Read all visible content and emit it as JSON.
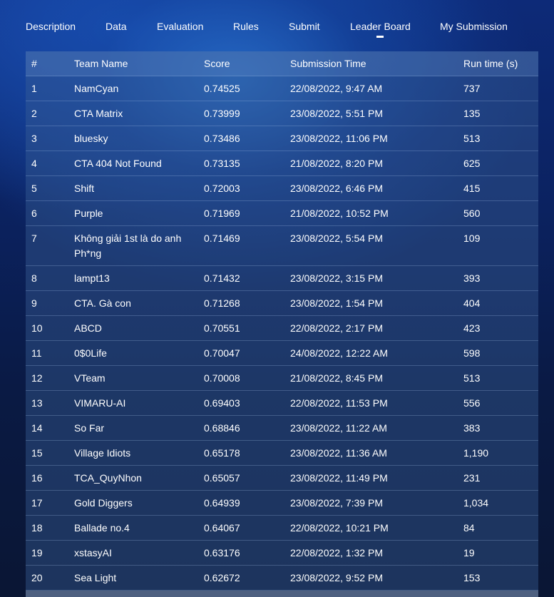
{
  "nav": {
    "items": [
      {
        "label": "Description"
      },
      {
        "label": "Data"
      },
      {
        "label": "Evaluation"
      },
      {
        "label": "Rules"
      },
      {
        "label": "Submit"
      },
      {
        "label": "Leader Board",
        "active": true
      },
      {
        "label": "My Submission"
      }
    ]
  },
  "table": {
    "headers": {
      "rank": "#",
      "team": "Team Name",
      "score": "Score",
      "time": "Submission Time",
      "run": "Run time (s)"
    },
    "rows": [
      {
        "rank": "1",
        "team": "NamCyan",
        "score": "0.74525",
        "time": "22/08/2022, 9:47 AM",
        "run": "737"
      },
      {
        "rank": "2",
        "team": "CTA Matrix",
        "score": "0.73999",
        "time": "23/08/2022, 5:51 PM",
        "run": "135"
      },
      {
        "rank": "3",
        "team": "bluesky",
        "score": "0.73486",
        "time": "23/08/2022, 11:06 PM",
        "run": "513"
      },
      {
        "rank": "4",
        "team": "CTA 404 Not Found",
        "score": "0.73135",
        "time": "21/08/2022, 8:20 PM",
        "run": "625"
      },
      {
        "rank": "5",
        "team": "Shift",
        "score": "0.72003",
        "time": "23/08/2022, 6:46 PM",
        "run": "415"
      },
      {
        "rank": "6",
        "team": "Purple",
        "score": "0.71969",
        "time": "21/08/2022, 10:52 PM",
        "run": "560"
      },
      {
        "rank": "7",
        "team": "Không giải 1st là do anh Ph*ng",
        "score": "0.71469",
        "time": "23/08/2022, 5:54 PM",
        "run": "109"
      },
      {
        "rank": "8",
        "team": "lampt13",
        "score": "0.71432",
        "time": "23/08/2022, 3:15 PM",
        "run": "393"
      },
      {
        "rank": "9",
        "team": "CTA. Gà con",
        "score": "0.71268",
        "time": "23/08/2022, 1:54 PM",
        "run": "404"
      },
      {
        "rank": "10",
        "team": "ABCD",
        "score": "0.70551",
        "time": "22/08/2022, 2:17 PM",
        "run": "423"
      },
      {
        "rank": "11",
        "team": "0$0Life",
        "score": "0.70047",
        "time": "24/08/2022, 12:22 AM",
        "run": "598"
      },
      {
        "rank": "12",
        "team": "VTeam",
        "score": "0.70008",
        "time": "21/08/2022, 8:45 PM",
        "run": "513"
      },
      {
        "rank": "13",
        "team": "VIMARU-AI",
        "score": "0.69403",
        "time": "22/08/2022, 11:53 PM",
        "run": "556"
      },
      {
        "rank": "14",
        "team": "So Far",
        "score": "0.68846",
        "time": "23/08/2022, 11:22 AM",
        "run": "383"
      },
      {
        "rank": "15",
        "team": "Village Idiots",
        "score": "0.65178",
        "time": "23/08/2022, 11:36 AM",
        "run": "1,190"
      },
      {
        "rank": "16",
        "team": "TCA_QuyNhon",
        "score": "0.65057",
        "time": "23/08/2022, 11:49 PM",
        "run": "231"
      },
      {
        "rank": "17",
        "team": "Gold Diggers",
        "score": "0.64939",
        "time": "23/08/2022, 7:39 PM",
        "run": "1,034"
      },
      {
        "rank": "18",
        "team": "Ballade no.4",
        "score": "0.64067",
        "time": "22/08/2022, 10:21 PM",
        "run": "84"
      },
      {
        "rank": "19",
        "team": "xstasyAI",
        "score": "0.63176",
        "time": "22/08/2022, 1:32 PM",
        "run": "19"
      },
      {
        "rank": "20",
        "team": "Sea Light",
        "score": "0.62672",
        "time": "23/08/2022, 9:52 PM",
        "run": "153"
      }
    ]
  }
}
